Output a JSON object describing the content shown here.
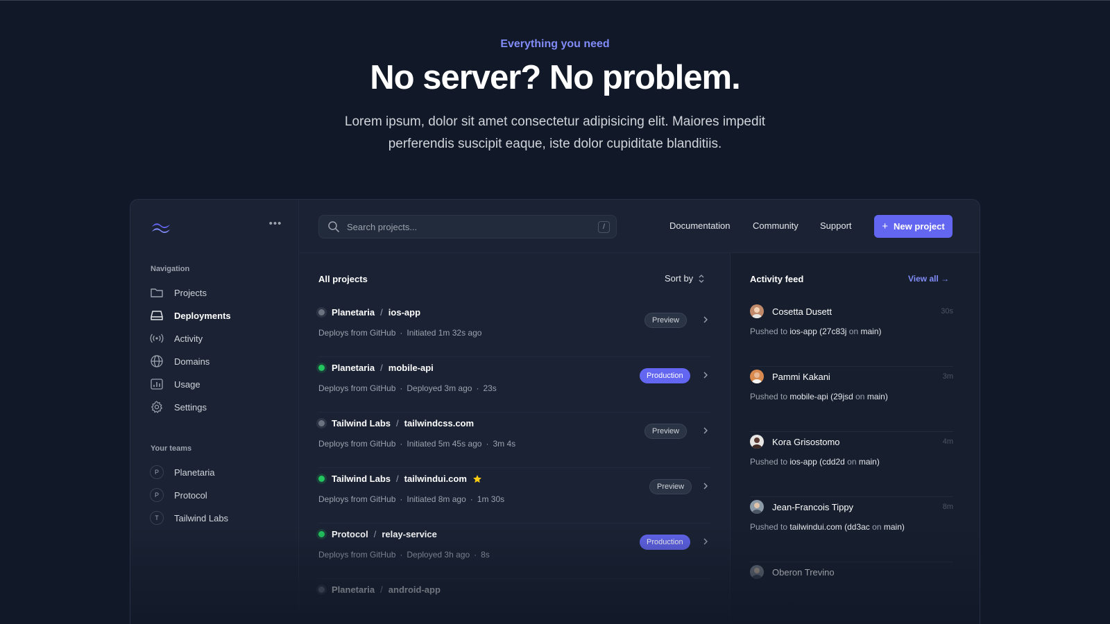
{
  "hero": {
    "eyebrow": "Everything you need",
    "headline": "No server? No problem.",
    "lede": "Lorem ipsum, dolor sit amet consectetur adipisicing elit. Maiores impedit perferendis suscipit eaque, iste dolor cupiditate blanditiis."
  },
  "sidebar": {
    "nav_label": "Navigation",
    "nav": [
      {
        "label": "Projects",
        "icon": "folder-icon"
      },
      {
        "label": "Deployments",
        "icon": "server-icon",
        "active": true
      },
      {
        "label": "Activity",
        "icon": "signal-icon"
      },
      {
        "label": "Domains",
        "icon": "globe-icon"
      },
      {
        "label": "Usage",
        "icon": "chart-bar-icon"
      },
      {
        "label": "Settings",
        "icon": "gear-icon"
      }
    ],
    "teams_label": "Your teams",
    "teams": [
      {
        "initial": "P",
        "label": "Planetaria"
      },
      {
        "initial": "P",
        "label": "Protocol"
      },
      {
        "initial": "T",
        "label": "Tailwind Labs"
      }
    ]
  },
  "topbar": {
    "search_placeholder": "Search projects...",
    "search_shortcut": "/",
    "links": [
      "Documentation",
      "Community",
      "Support"
    ],
    "new_project": "New project",
    "new_project_plus": "+"
  },
  "projects": {
    "title": "All projects",
    "sort_label": "Sort by",
    "sep": "/",
    "meta_dot": "·",
    "rows": [
      {
        "team": "Planetaria",
        "repo": "ios-app",
        "status": "gray",
        "meta": [
          "Deploys from GitHub",
          "Initiated 1m 32s ago"
        ],
        "env": "Preview",
        "starred": false
      },
      {
        "team": "Planetaria",
        "repo": "mobile-api",
        "status": "green",
        "meta": [
          "Deploys from GitHub",
          "Deployed 3m ago",
          "23s"
        ],
        "env": "Production",
        "starred": false
      },
      {
        "team": "Tailwind Labs",
        "repo": "tailwindcss.com",
        "status": "gray",
        "meta": [
          "Deploys from GitHub",
          "Initiated 5m 45s ago",
          "3m 4s"
        ],
        "env": "Preview",
        "starred": false
      },
      {
        "team": "Tailwind Labs",
        "repo": "tailwindui.com",
        "status": "green",
        "meta": [
          "Deploys from GitHub",
          "Initiated 8m ago",
          "1m 30s"
        ],
        "env": "Preview",
        "starred": true
      },
      {
        "team": "Protocol",
        "repo": "relay-service",
        "status": "green",
        "meta": [
          "Deploys from GitHub",
          "Deployed 3h ago",
          "8s"
        ],
        "env": "Production",
        "starred": false
      },
      {
        "team": "Planetaria",
        "repo": "android-app",
        "status": "gray",
        "meta": [],
        "env": "",
        "starred": false
      }
    ]
  },
  "activity": {
    "title": "Activity feed",
    "view_all": "View all →",
    "items": [
      {
        "name": "Cosetta Dusett",
        "time": "30s",
        "prefix": "Pushed to",
        "repo": "ios-app",
        "commit": "(27c83j",
        "on": "on",
        "branch": "main)",
        "avatar_color": "#c08a6a"
      },
      {
        "name": "Pammi Kakani",
        "time": "3m",
        "prefix": "Pushed to",
        "repo": "mobile-api",
        "commit": "(29jsd",
        "on": "on",
        "branch": "main)",
        "avatar_color": "#d98a4e"
      },
      {
        "name": "Kora Grisostomo",
        "time": "4m",
        "prefix": "Pushed to",
        "repo": "ios-app",
        "commit": "(cdd2d",
        "on": "on",
        "branch": "main)",
        "avatar_color": "#5a3a32"
      },
      {
        "name": "Jean-Francois Tippy",
        "time": "8m",
        "prefix": "Pushed to",
        "repo": "tailwindui.com",
        "commit": "(dd3ac",
        "on": "on",
        "branch": "main)",
        "avatar_color": "#8d9aa8"
      },
      {
        "name": "Oberon Trevino",
        "time": "",
        "prefix": "",
        "repo": "",
        "commit": "",
        "on": "",
        "branch": "",
        "avatar_color": "#6f7885"
      }
    ]
  },
  "colors": {
    "accent": "#6366f1",
    "accent_text": "#818cf8",
    "success": "#22c55e",
    "background": "#111827"
  }
}
